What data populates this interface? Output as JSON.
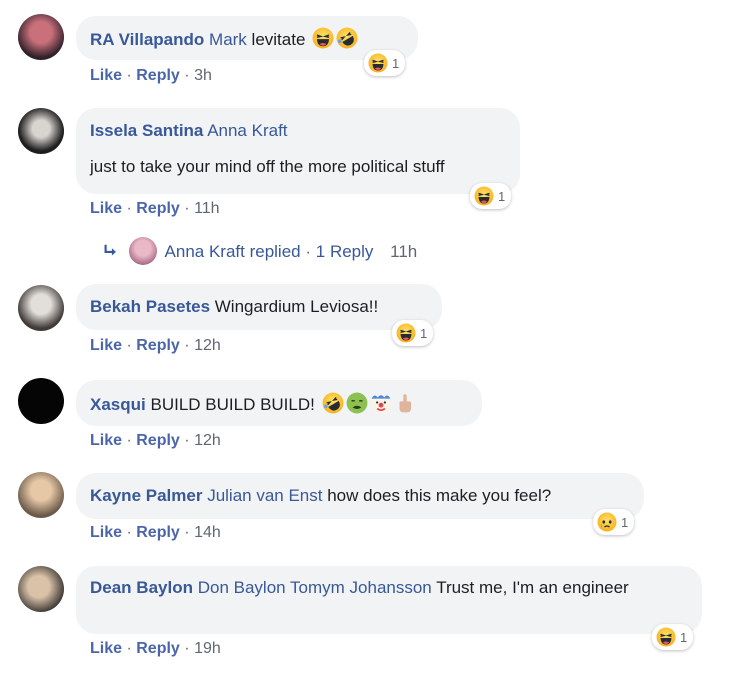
{
  "comments": [
    {
      "author": "RA Villapando",
      "tags": [
        "Mark"
      ],
      "text": "levitate",
      "like": "Like",
      "reply": "Reply",
      "time": "3h",
      "reaction_count": "1"
    },
    {
      "author": "Issela Santina",
      "tags": [
        "Anna Kraft"
      ],
      "text": "just to take your mind off the more political stuff",
      "like": "Like",
      "reply": "Reply",
      "time": "11h",
      "reaction_count": "1"
    },
    {
      "author": "Bekah Pasetes",
      "tags": [],
      "text": "Wingardium Leviosa!!",
      "like": "Like",
      "reply": "Reply",
      "time": "12h",
      "reaction_count": "1"
    },
    {
      "author": "Xasqui",
      "tags": [],
      "text": "BUILD BUILD BUILD!",
      "like": "Like",
      "reply": "Reply",
      "time": "12h"
    },
    {
      "author": "Kayne Palmer",
      "tags": [
        "Julian van Enst"
      ],
      "text": "how does this make you feel?",
      "like": "Like",
      "reply": "Reply",
      "time": "14h",
      "reaction_count": "1"
    },
    {
      "author": "Dean Baylon",
      "tags": [
        "Don Baylon",
        "Tomym Johansson"
      ],
      "text": "Trust me, I'm an engineer",
      "like": "Like",
      "reply": "Reply",
      "time": "19h",
      "reaction_count": "1"
    }
  ],
  "reply_thread": {
    "label": "Anna Kraft replied",
    "count": "1 Reply",
    "time": "11h"
  },
  "separator": "·",
  "colors": {
    "link": "#385898",
    "bubble": "#f2f3f5",
    "meta": "#606770"
  }
}
